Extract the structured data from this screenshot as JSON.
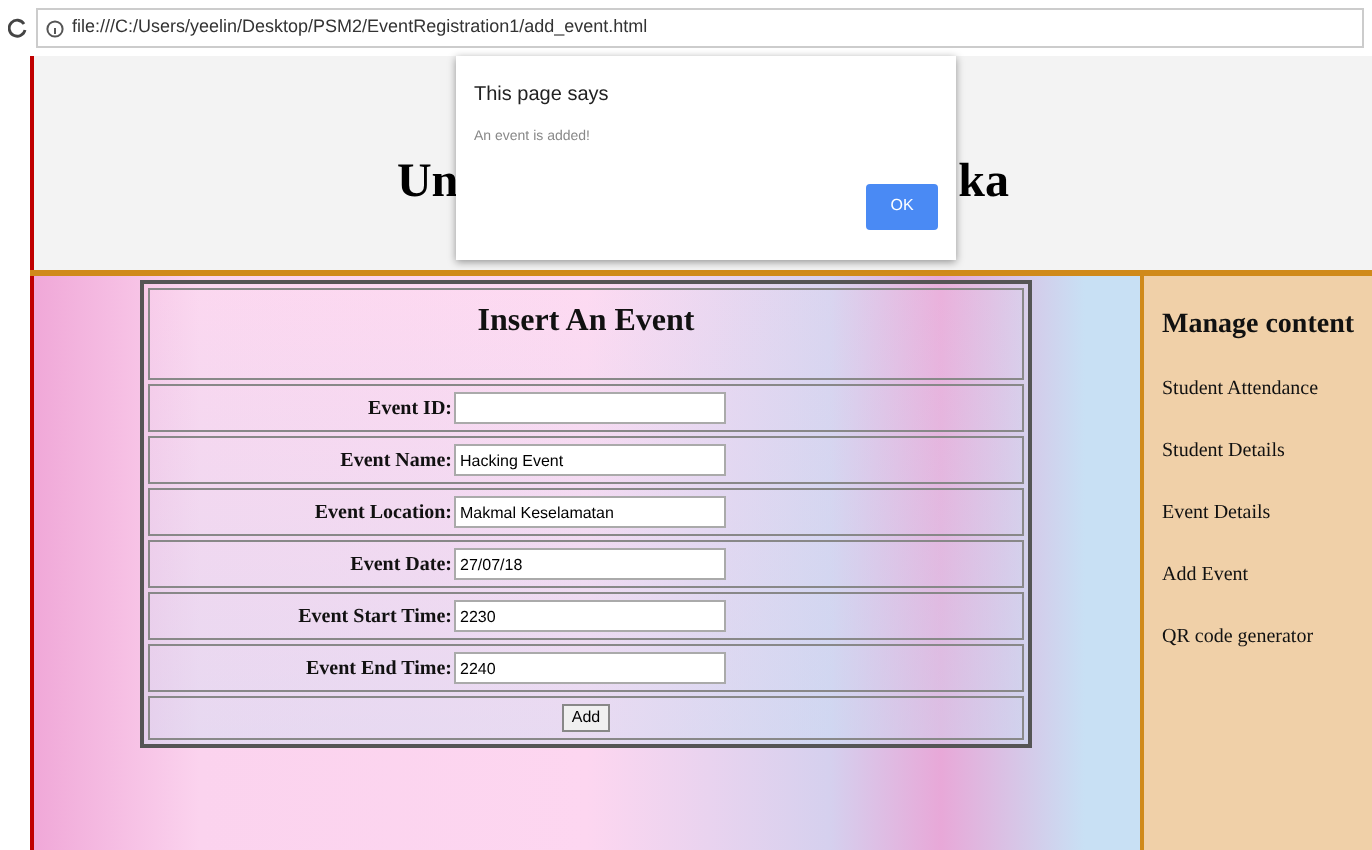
{
  "address_bar": {
    "url": "file:///C:/Users/yeelin/Desktop/PSM2/EventRegistration1/add_event.html"
  },
  "header": {
    "title_left": "Un",
    "title_right": "ka"
  },
  "dialog": {
    "title": "This page says",
    "message": "An event is added!",
    "button": "OK"
  },
  "form": {
    "title": "Insert An Event",
    "fields": [
      {
        "label": "Event ID:"
      },
      {
        "label": "Event Name:",
        "value": "Hacking Event"
      },
      {
        "label": "Event Location:",
        "value": "Makmal Keselamatan"
      },
      {
        "label": "Event Date:",
        "value": "27/07/18"
      },
      {
        "label": "Event Start Time:",
        "value": "2230"
      },
      {
        "label": "Event End Time:",
        "value": "2240"
      }
    ],
    "submit": "Add"
  },
  "sidebar": {
    "title": "Manage content",
    "items": [
      "Student Attendance",
      "Student Details",
      "Event Details",
      "Add Event",
      "QR code generator"
    ]
  }
}
